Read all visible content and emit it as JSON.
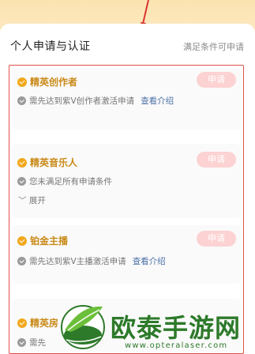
{
  "header": {
    "section_title": "个人申请与认证",
    "section_hint": "满足条件可申请"
  },
  "cards": [
    {
      "name": "精英创作者",
      "apply_label": "申请",
      "condition": "需先达到紫V创作者激活申请",
      "link": "查看介绍"
    },
    {
      "name": "精英音乐人",
      "apply_label": "申请",
      "condition": "您未满足所有申请条件",
      "expand": "﹀ 展开"
    },
    {
      "name": "铂金主播",
      "apply_label": "申请",
      "condition": "需先达到紫V主播激活申请",
      "link": "查看介绍"
    },
    {
      "name": "精英房",
      "apply_label": "",
      "condition": "需先"
    }
  ],
  "watermark": {
    "brand": "欧泰手游网",
    "url": "www.opteralaser.com"
  },
  "colors": {
    "accent_gold": "#c98a18",
    "apply_pink": "#fcd2d2",
    "highlight_red": "#e0524b",
    "link_blue": "#4a6fa5",
    "watermark_green": "#2d7a2a"
  }
}
